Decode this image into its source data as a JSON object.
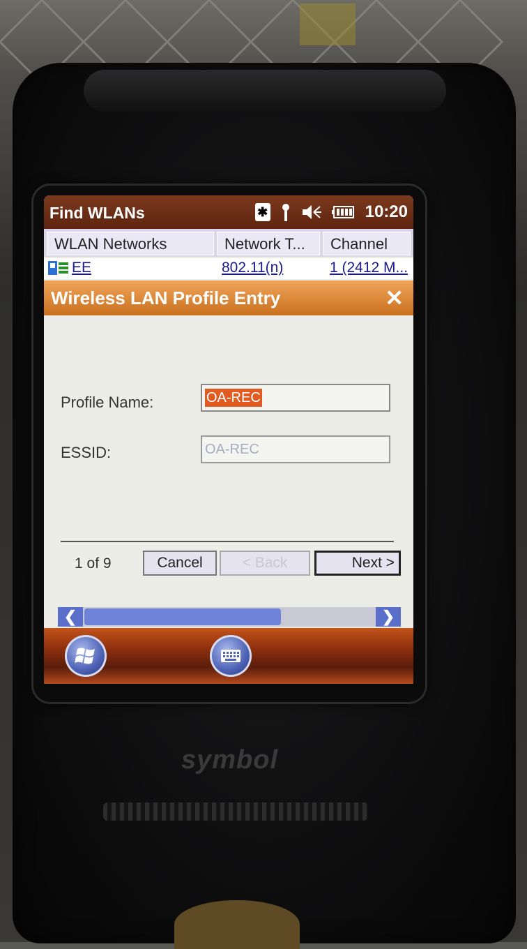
{
  "titlebar": {
    "title": "Find WLANs",
    "time": "10:20",
    "icons": [
      "bluetooth-icon",
      "signal-antenna-icon",
      "speaker-muted-icon",
      "battery-icon"
    ]
  },
  "list": {
    "columns": [
      "WLAN Networks",
      "Network T...",
      "Channel"
    ],
    "rows": [
      {
        "name": "EE",
        "network_type": "802.11(n)",
        "channel": "1 (2412 M..."
      }
    ]
  },
  "dialog": {
    "title": "Wireless LAN Profile Entry",
    "close_label": "✕",
    "profile_name_label": "Profile Name:",
    "profile_name_value": "OA-REC",
    "essid_label": "ESSID:",
    "essid_value": "OA-REC",
    "pager": "1 of 9",
    "cancel_label": "Cancel",
    "back_label": "< Back",
    "next_label": "Next >"
  },
  "device": {
    "brand": "symbol"
  },
  "colors": {
    "titlebar": "#5e2410",
    "dialog_header": "#c9701f",
    "selection": "#e05a22",
    "scrollbar": "#5a6fc9"
  }
}
